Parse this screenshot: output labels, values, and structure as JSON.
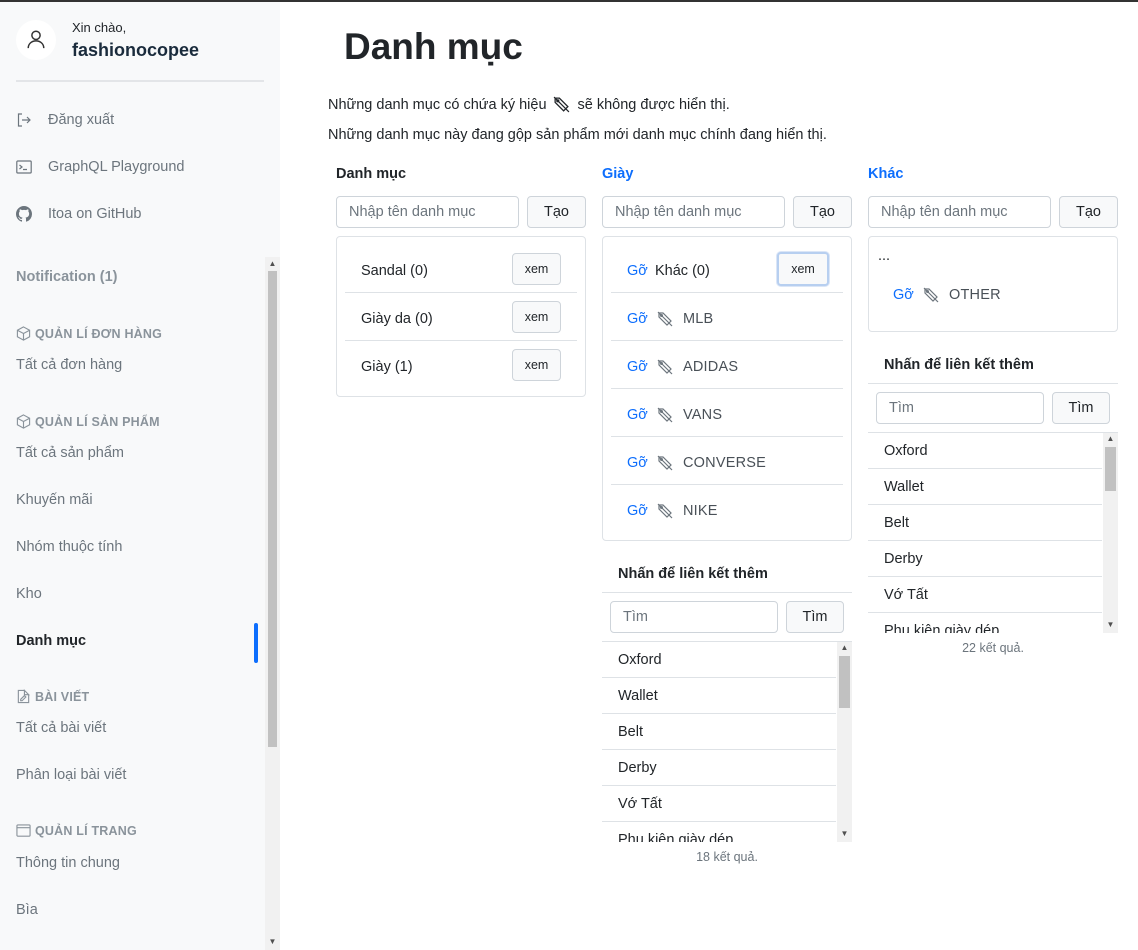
{
  "sidebar": {
    "greeting": "Xin chào,",
    "username": "fashionocopee",
    "links": [
      {
        "label": "Đăng xuất",
        "icon": "logout-icon"
      },
      {
        "label": "GraphQL Playground",
        "icon": "terminal-icon"
      },
      {
        "label": "Itoa on GitHub",
        "icon": "github-icon"
      }
    ],
    "notification": "Notification (1)",
    "sections": {
      "orders": {
        "title": "QUẢN LÍ ĐƠN HÀNG",
        "items": [
          "Tất cả đơn hàng"
        ]
      },
      "products": {
        "title": "QUẢN LÍ SẢN PHẨM",
        "items": [
          "Tất cả sản phẩm",
          "Khuyến mãi",
          "Nhóm thuộc tính",
          "Kho",
          "Danh mục"
        ]
      },
      "posts": {
        "title": "BÀI VIẾT",
        "items": [
          "Tất cả bài viết",
          "Phân loại bài viết"
        ]
      },
      "pages": {
        "title": "QUẢN LÍ TRANG",
        "items": [
          "Thông tin chung",
          "Bìa"
        ]
      }
    },
    "active_item": "Danh mục"
  },
  "main": {
    "title": "Danh mục",
    "note1_before": "Những danh mục có chứa ký hiệu",
    "note1_after": "sẽ không được hiển thị.",
    "note2": "Những danh mục này đang gộp sản phẩm mới danh mục chính đang hiển thị.",
    "input_placeholder": "Nhập tên danh mục",
    "create_label": "Tạo",
    "view_label": "xem",
    "remove_label": "Gỡ",
    "link_more": "Nhấn để liên kết thêm",
    "search_placeholder": "Tìm",
    "search_label": "Tìm",
    "columns": [
      {
        "title": "Danh mục",
        "items": [
          "Sandal (0)",
          "Giày da (0)",
          "Giày (1)"
        ]
      },
      {
        "title": "Giày",
        "first": "Khác (0)",
        "hidden_items": [
          "MLB",
          "ADIDAS",
          "VANS",
          "CONVERSE",
          "NIKE"
        ],
        "link_list": [
          "Oxford",
          "Wallet",
          "Belt",
          "Derby",
          "Vớ Tất",
          "Phụ kiện giày dép"
        ],
        "count": "18 kết quả."
      },
      {
        "title": "Khác",
        "ellipsis": "...",
        "hidden_items": [
          "OTHER"
        ],
        "link_list": [
          "Oxford",
          "Wallet",
          "Belt",
          "Derby",
          "Vớ Tất",
          "Phụ kiện giày dép"
        ],
        "count": "22 kết quả."
      }
    ]
  }
}
